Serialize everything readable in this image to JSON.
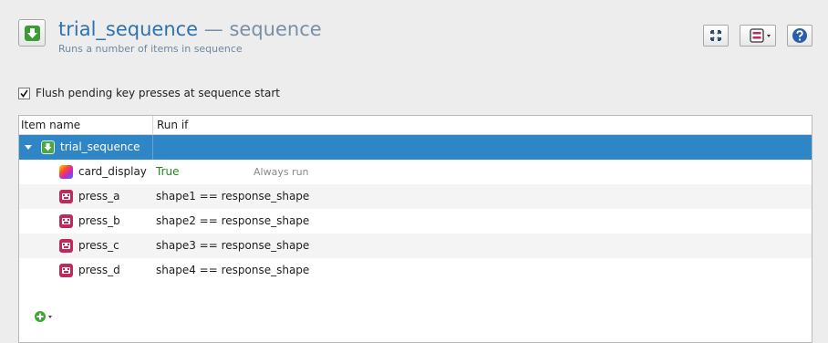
{
  "header": {
    "item_name": "trial_sequence",
    "separator": "—",
    "item_type": "sequence",
    "description": "Runs a number of items in sequence",
    "icons": [
      "sequence-icon",
      "fullscreen-icon",
      "view-menu-icon",
      "help-icon"
    ]
  },
  "options": {
    "flush_label": "Flush pending key presses at sequence start",
    "flush_checked": true
  },
  "tree": {
    "columns": [
      "Item name",
      "Run if"
    ],
    "root": {
      "name": "trial_sequence",
      "run_if": "",
      "selected": true
    },
    "items": [
      {
        "name": "card_display",
        "icon": "sketchpad-icon",
        "run_if": "True",
        "note": "Always run"
      },
      {
        "name": "press_a",
        "icon": "keyboard-icon",
        "run_if": "shape1 == response_shape",
        "note": ""
      },
      {
        "name": "press_b",
        "icon": "keyboard-icon",
        "run_if": "shape2 == response_shape",
        "note": ""
      },
      {
        "name": "press_c",
        "icon": "keyboard-icon",
        "run_if": "shape3 == response_shape",
        "note": ""
      },
      {
        "name": "press_d",
        "icon": "keyboard-icon",
        "run_if": "shape4 == response_shape",
        "note": ""
      }
    ]
  },
  "colors": {
    "title": "#2f72b0",
    "selection": "#2f86c6",
    "run_if_true": "#1e8a1e",
    "keyboard_icon": "#c02a5a"
  }
}
